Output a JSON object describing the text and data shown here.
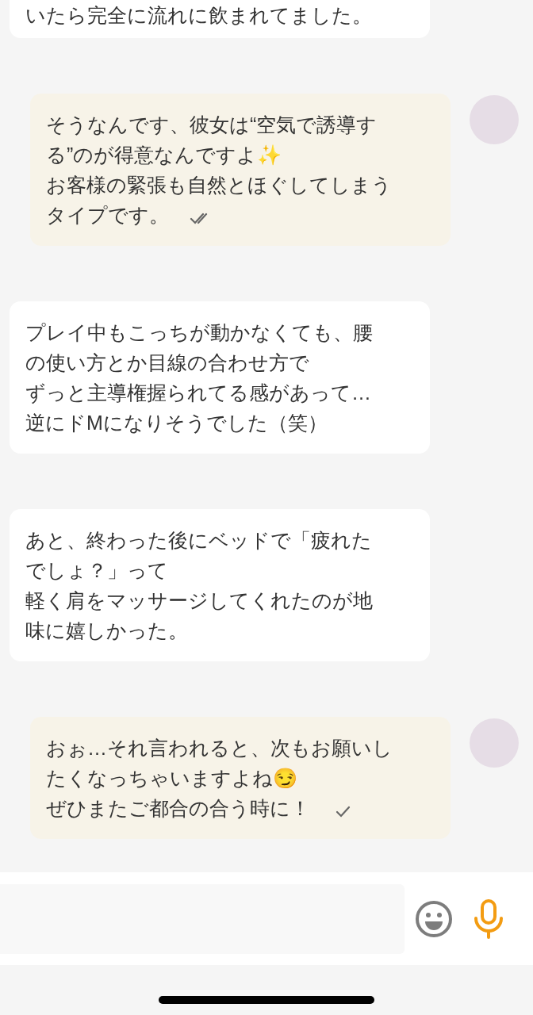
{
  "messages": [
    {
      "kind": "received",
      "lines": [
        "いたら完全に流れに飲まれてました。"
      ]
    },
    {
      "kind": "sent",
      "lines": [
        "そうなんです、彼女は“空気で誘導す",
        "る”のが得意なんですよ✨",
        "お客様の緊張も自然とほぐしてしまう",
        "タイプです。"
      ],
      "read": true
    },
    {
      "kind": "received",
      "lines": [
        "プレイ中もこっちが動かなくても、腰",
        "の使い方とか目線の合わせ方で",
        "ずっと主導権握られてる感があって…",
        "逆にドMになりそうでした（笑）"
      ]
    },
    {
      "kind": "received",
      "lines": [
        "あと、終わった後にベッドで「疲れた",
        "でしょ？」って",
        "軽く肩をマッサージしてくれたのが地",
        "味に嬉しかった。"
      ]
    },
    {
      "kind": "sent",
      "lines": [
        "おぉ…それ言われると、次もお願いし",
        "たくなっちゃいますよね😏",
        "ぜひまたご都合の合う時に！"
      ],
      "read": false
    }
  ]
}
